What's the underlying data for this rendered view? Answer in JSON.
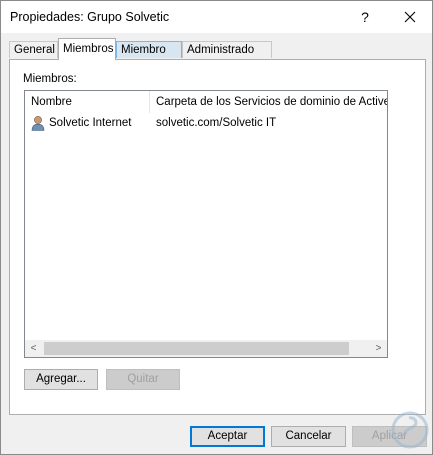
{
  "window": {
    "title": "Propiedades: Grupo Solvetic",
    "help_label": "?",
    "close_icon": "close-icon"
  },
  "tabs": [
    {
      "label": "General",
      "active": false
    },
    {
      "label": "Miembros",
      "active": true
    },
    {
      "label": "Miembro de",
      "active": false
    },
    {
      "label": "Administrado por",
      "active": false
    }
  ],
  "members": {
    "label": "Miembros:",
    "columns": [
      "Nombre",
      "Carpeta de los Servicios de dominio de Active Directory"
    ],
    "rows": [
      {
        "name": "Solvetic Internet",
        "folder": "solvetic.com/Solvetic IT",
        "icon": "user-icon"
      }
    ],
    "scroll_left": "<",
    "scroll_right": ">"
  },
  "actions": {
    "add_label": "Agregar...",
    "remove_label": "Quitar"
  },
  "footer": {
    "ok_label": "Aceptar",
    "cancel_label": "Cancelar",
    "apply_label": "Aplicar"
  },
  "colors": {
    "accent": "#0078d7",
    "tab_hover": "#d8e6f2"
  }
}
